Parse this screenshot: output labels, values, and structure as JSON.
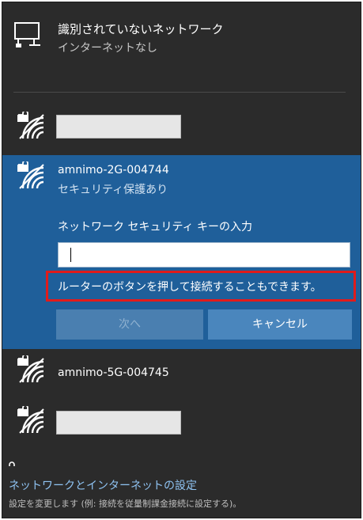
{
  "unidentified_network": {
    "name": "識別されていないネットワーク",
    "status": "インターネットなし"
  },
  "networks": [
    {
      "name": "",
      "redacted": true
    },
    {
      "name": "amnimo-2G-004744",
      "status": "セキュリティ保護あり",
      "selected": true
    },
    {
      "name": "amnimo-5G-004745"
    },
    {
      "name": "",
      "redacted": true
    }
  ],
  "connect_form": {
    "key_label": "ネットワーク セキュリティ キーの入力",
    "key_value": "",
    "router_hint": "ルーターのボタンを押して接続することもできます。",
    "next_label": "次へ",
    "cancel_label": "キャンセル"
  },
  "footer": {
    "settings_link": "ネットワークとインターネットの設定",
    "settings_desc": "設定を変更します (例: 接続を従量制課金接続に設定する)。"
  },
  "colors": {
    "panel_bg": "#2b2b2b",
    "selected_bg": "#1f5f9a",
    "highlight_border": "#e11b1b",
    "link": "#8fc3f2"
  },
  "icons": {
    "ethernet": "ethernet-icon",
    "wifi_secured": "wifi-secured-icon"
  }
}
